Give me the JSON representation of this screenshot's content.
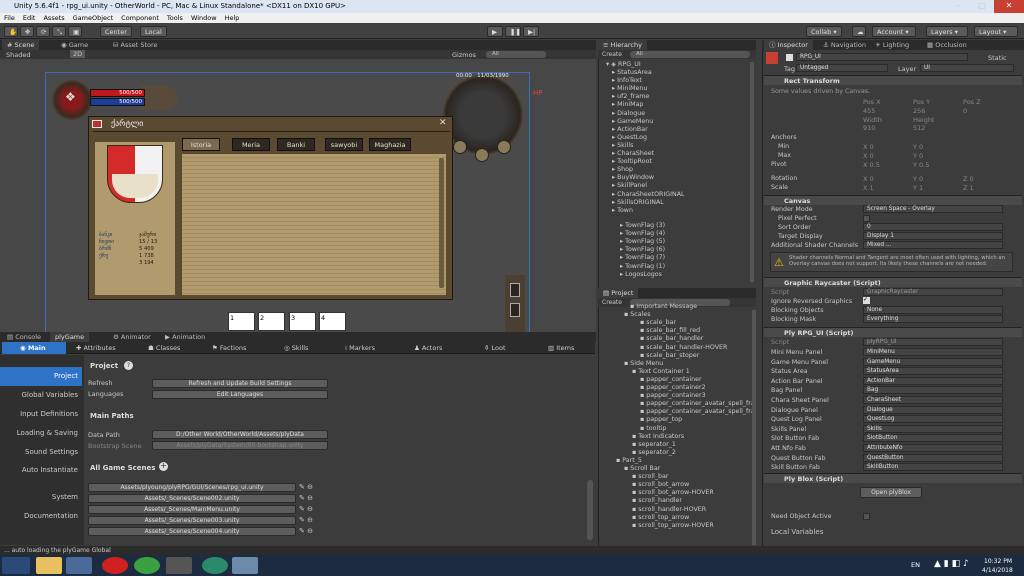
{
  "window": {
    "title": "Unity 5.6.4f1 - rpg_ui.unity - OtherWorld - PC, Mac & Linux Standalone* <DX11 on DX10 GPU>"
  },
  "menu": [
    "File",
    "Edit",
    "Assets",
    "GameObject",
    "Component",
    "Tools",
    "Window",
    "Help"
  ],
  "toolbar": {
    "center": "Center",
    "local": "Local",
    "collab": "Collab",
    "account": "Account",
    "layers": "Layers",
    "layout": "Layout"
  },
  "scene_tabs": {
    "scene": "Scene",
    "game": "Game",
    "asset_store": "Asset Store",
    "shaded": "Shaded",
    "two_d": "2D",
    "gizmos": "Gizmos",
    "search": "All"
  },
  "game_view": {
    "hp": "500/500",
    "mp": "500/500",
    "hp_label": "HP",
    "clock": "00:00",
    "date": "11/03/1990"
  },
  "dialog": {
    "title": "ქარტლი",
    "tabs": [
      "Istoria",
      "Meria",
      "Banki",
      "sawyobi",
      "Maghazia"
    ],
    "stats_left": [
      "ბანკი",
      "ნივთი",
      "ბრძნ",
      "ქრე"
    ],
    "stats_right": [
      "ჯამური",
      "15 / 13",
      "5 409",
      "1 738",
      "3 194"
    ],
    "slots": [
      "1",
      "2",
      "3",
      "4"
    ]
  },
  "bottom_tabs": {
    "console": "Console",
    "plygame": "plyGame",
    "animator": "Animator",
    "animation": "Animation"
  },
  "ply_tabs": [
    "Main",
    "Attributes",
    "Classes",
    "Factions",
    "Skills",
    "Markers",
    "Actors",
    "Loot",
    "Items"
  ],
  "ply_nav": [
    "Project",
    "Global Variables",
    "Input Definitions",
    "Loading & Saving",
    "Sound Settings",
    "Auto Instantiate",
    "System",
    "Documentation"
  ],
  "ply_project": {
    "project_label": "Project",
    "refresh": "Refresh",
    "refresh_btn": "Refresh and Update Build Settings",
    "languages": "Languages",
    "languages_btn": "Edit Languages",
    "main_paths": "Main Paths",
    "data_path": "Data Path",
    "data_path_val": "D:/Other World/OtherWorld/Assets/plyData",
    "bootstrap": "Bootstrap Scene",
    "bootstrap_val": "Assets/plyData/System/00-bootstrap.unity",
    "all_scenes": "All Game Scenes",
    "scenes": [
      "Assets/plyoung/plyRPG/GUI/Scenes/rpg_ui.unity",
      "Assets/_Scenes/Scene002.unity",
      "Assets/_Scenes/MainMenu.unity",
      "Assets/_Scenes/Scene003.unity",
      "Assets/_Scenes/Scene004.unity"
    ]
  },
  "hierarchy": {
    "title": "Hierarchy",
    "create": "Create",
    "search": "All",
    "root": "RPG_UI",
    "items": [
      "StatusArea",
      "InfoText",
      "MiniMenu",
      "uf2_frame",
      "MiniMap",
      "Dialogue",
      "GameMenu",
      "ActionBar",
      "QuestLog",
      "Skills",
      "CharaSheet",
      "TooltipRoot",
      "Shop",
      "BuyWindow",
      "SkillPanel",
      "CharaSheetORIGINAL",
      "SkillsORIGINAL",
      "Town"
    ],
    "town_items": [
      "TownFlag (3)",
      "TownFlag (4)",
      "TownFlag (5)",
      "TownFlag (6)",
      "TownFlag (7)",
      "TownFlag (1)",
      "LogosLogos"
    ]
  },
  "project": {
    "title": "Project",
    "create": "Create",
    "items": [
      "Important Message",
      "Scales",
      "scale_bar",
      "scale_bar_fill_red",
      "scale_bar_handler",
      "scale_bar_handler-HOVER",
      "scale_bar_stoper",
      "Side Menu",
      "Text Container 1",
      "papper_container",
      "papper_container2",
      "papper_container3",
      "papper_container_avatar_spell_fra",
      "papper_container_avatar_spell_fra",
      "papper_top",
      "tooltip",
      "Text Indicators",
      "seperator_1",
      "seperator_2",
      "Part_5",
      "Scroll Bar",
      "scroll_bar",
      "scroll_bot_arrow",
      "scroll_bot_arrow-HOVER",
      "scroll_handler",
      "scroll_handler-HOVER",
      "scroll_top_arrow",
      "scroll_top_arrow-HOVER"
    ]
  },
  "inspector": {
    "tabs": [
      "Inspector",
      "Navigation",
      "Lighting",
      "Occlusion"
    ],
    "name": "RPG_UI",
    "static": "Static",
    "tag_label": "Tag",
    "tag": "Untagged",
    "layer_label": "Layer",
    "layer": "UI",
    "rect_transform": "Rect Transform",
    "driven": "Some values driven by Canvas.",
    "pos_labels": [
      "Pos X",
      "Pos Y",
      "Pos Z"
    ],
    "pos_vals": [
      "455",
      "256",
      "0"
    ],
    "size_labels": [
      "Width",
      "Height"
    ],
    "size_vals": [
      "910",
      "512"
    ],
    "anchors": "Anchors",
    "min": "Min",
    "max": "Max",
    "pivot": "Pivot",
    "rotation": "Rotation",
    "scale": "Scale",
    "min_vals": [
      "X 0",
      "Y 0"
    ],
    "max_vals": [
      "X 0",
      "Y 0"
    ],
    "pivot_vals": [
      "X 0.5",
      "Y 0.5"
    ],
    "rot_vals": [
      "X 0",
      "Y 0",
      "Z 0"
    ],
    "scale_vals": [
      "X 1",
      "Y 1",
      "Z 1"
    ],
    "canvas": "Canvas",
    "render_mode": "Render Mode",
    "render_mode_val": "Screen Space - Overlay",
    "pixel_perfect": "Pixel Perfect",
    "sort_order": "Sort Order",
    "sort_order_val": "0",
    "target_display": "Target Display",
    "target_display_val": "Display 1",
    "shader_channels": "Additional Shader Channels",
    "shader_channels_val": "Mixed ...",
    "warning": "Shader channels Normal and Tangent are most often used with lighting, which an Overlay canvas does not support. Its likely these channels are not needed.",
    "raycaster": "Graphic Raycaster (Script)",
    "script": "Script",
    "raycaster_script": "GraphicRaycaster",
    "ignore_reversed": "Ignore Reversed Graphics",
    "blocking_objects": "Blocking Objects",
    "blocking_objects_val": "None",
    "blocking_mask": "Blocking Mask",
    "blocking_mask_val": "Everything",
    "ply_rpg_ui": "Ply RPG_UI (Script)",
    "ply_script": "plyRPG_UI",
    "ply_fields": [
      [
        "Mini Menu Panel",
        "MiniMenu"
      ],
      [
        "Game Menu Panel",
        "GameMenu"
      ],
      [
        "Status Area",
        "StatusArea"
      ],
      [
        "Action Bar Panel",
        "ActionBar"
      ],
      [
        "Bag Panel",
        "Bag"
      ],
      [
        "Chara Sheet Panel",
        "CharaSheet"
      ],
      [
        "Dialogue Panel",
        "Dialogue"
      ],
      [
        "Quest Log Panel",
        "QuestLog"
      ],
      [
        "Skills Panel",
        "Skills"
      ],
      [
        "Slot Button Fab",
        "SlotButton"
      ],
      [
        "Att Nfo Fab",
        "AttributeNfo"
      ],
      [
        "Quest Button Fab",
        "QuestButton"
      ],
      [
        "Skill Button Fab",
        "SkillButton"
      ]
    ],
    "ply_blox": "Ply Blox (Script)",
    "open_blox": "Open plyBlox",
    "need_object": "Need Object Active",
    "local_vars": "Local Variables"
  },
  "status": "... auto loading the plyGame Global",
  "taskbar": {
    "lang": "EN",
    "time": "10:32 PM",
    "date": "4/14/2018"
  }
}
